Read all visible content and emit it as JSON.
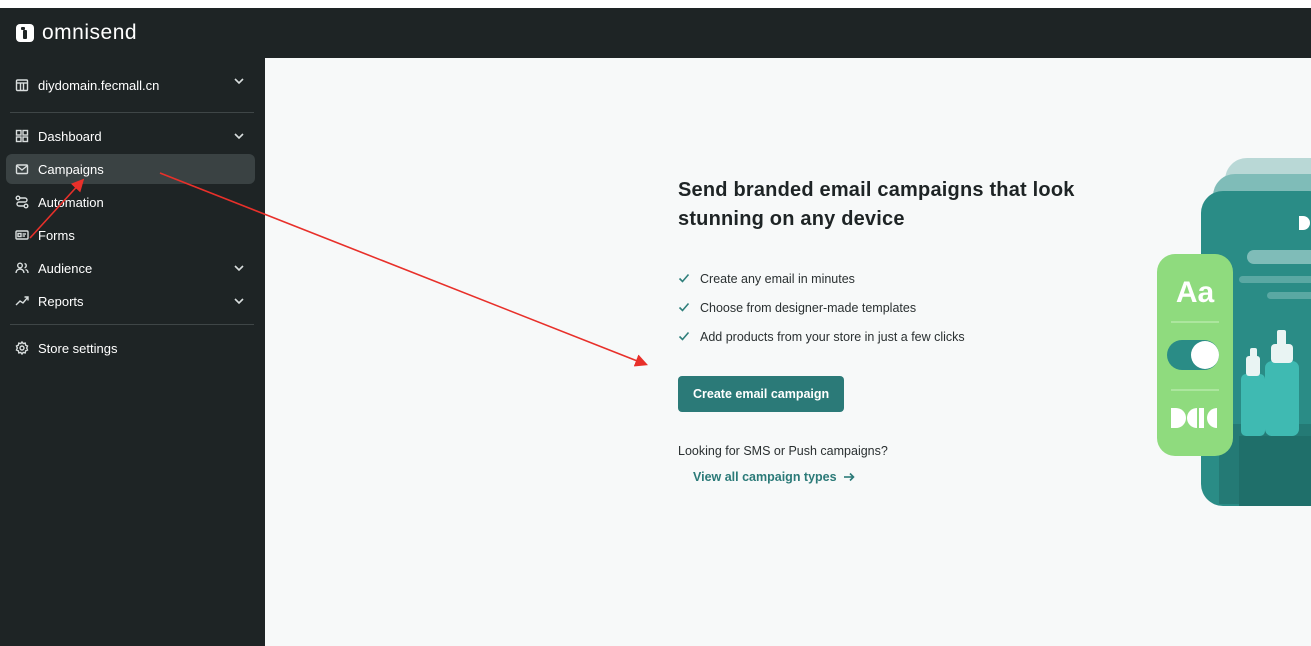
{
  "app": {
    "logo_text": "omnisend"
  },
  "sidebar": {
    "store": {
      "label": "diydomain.fecmall.cn",
      "icon": "store-icon"
    },
    "items": [
      {
        "label": "Dashboard",
        "icon": "dashboard-grid-icon",
        "expandable": true
      },
      {
        "label": "Campaigns",
        "icon": "mail-icon",
        "active": true
      },
      {
        "label": "Automation",
        "icon": "automation-flow-icon"
      },
      {
        "label": "Forms",
        "icon": "forms-icon"
      },
      {
        "label": "Audience",
        "icon": "audience-icon",
        "expandable": true
      },
      {
        "label": "Reports",
        "icon": "trend-icon",
        "expandable": true
      }
    ],
    "settings": {
      "label": "Store settings",
      "icon": "gear-icon"
    }
  },
  "main": {
    "headline": "Send branded email campaigns that look stunning on any device",
    "features": [
      "Create any email in minutes",
      "Choose from designer-made templates",
      "Add products from your store in just a few clicks"
    ],
    "cta_label": "Create email campaign",
    "sms_prompt": "Looking for SMS or Push campaigns?",
    "view_all_label": "View all campaign types",
    "illustration_text": "Aa"
  },
  "colors": {
    "sidebar_bg": "#1e2425",
    "accent": "#2b7a78",
    "main_bg": "#f7f9f9",
    "annotation_arrow": "#e8302a"
  }
}
